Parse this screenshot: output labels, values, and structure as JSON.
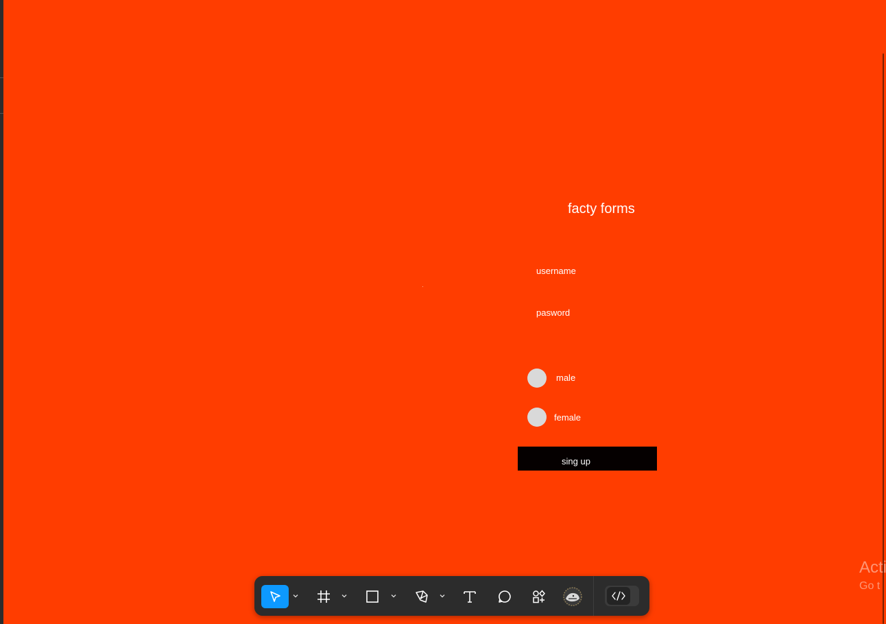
{
  "form": {
    "title": "facty forms",
    "username_label": "username",
    "password_label": "pasword",
    "gender_options": [
      "male",
      "female"
    ],
    "signup_label": "sing up"
  },
  "toolbar": {
    "tools": [
      "move-tool",
      "frame-tool",
      "rectangle-tool",
      "pen-tool",
      "text-tool",
      "comment-tool",
      "assets-tool",
      "plugin-avatar",
      "dev-mode-toggle"
    ]
  },
  "watermark": {
    "line1": "Acti",
    "line2": "Go t"
  },
  "colors": {
    "canvas": "#ff3d00",
    "toolbar": "#2c2c2c",
    "accent": "#0d99ff",
    "button": "#050000",
    "radio": "#d9d9d9"
  }
}
